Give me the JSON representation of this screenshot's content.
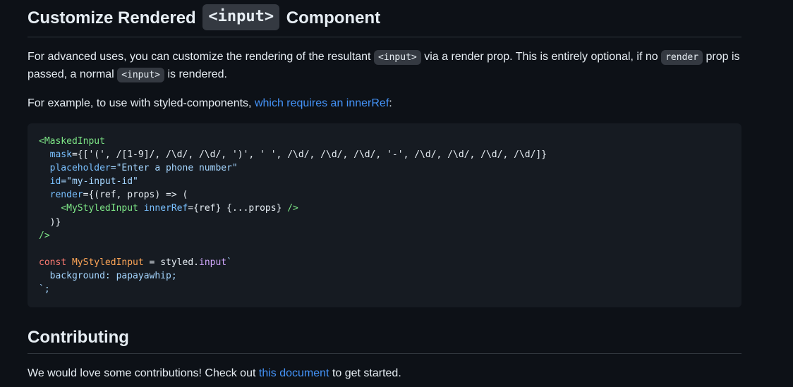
{
  "section1": {
    "heading_before": "Customize Rendered",
    "heading_code": "<input>",
    "heading_after": "Component",
    "p1": {
      "t1": "For advanced uses, you can customize the rendering of the resultant",
      "code1": "<input>",
      "t2": "via a render prop. This is entirely optional, if no",
      "code2": "render",
      "t3": "prop is passed, a normal",
      "code3": "<input>",
      "t4": "is rendered."
    },
    "p2": {
      "t1": "For example, to use with styled-components,",
      "link": "which requires an innerRef",
      "t2": ":"
    }
  },
  "code_block": {
    "l1_tag": "<MaskedInput",
    "l2_attr": "mask",
    "l2_val": "={['(', /[1-9]/, /\\d/, /\\d/, ')', ' ', /\\d/, /\\d/, /\\d/, '-', /\\d/, /\\d/, /\\d/, /\\d/]}",
    "l3_attr": "placeholder",
    "l3_val": "=\"Enter a phone number\"",
    "l4_attr": "id",
    "l4_val": "=\"my-input-id\"",
    "l5_attr": "render",
    "l5_val": "={(ref, props) => (",
    "l6_tag": "<MyStyledInput",
    "l6_attr": "innerRef",
    "l6_val": "={ref} {...props}",
    "l6_close": "/>",
    "l7": ")}",
    "l8": "/>",
    "l10_kw": "const",
    "l10_name": "MyStyledInput",
    "l10_eq": " = styled.",
    "l10_fn": "input",
    "l10_tick": "`",
    "l11": "  background: papayawhip;",
    "l12": "`;"
  },
  "section2": {
    "heading": "Contributing",
    "p": {
      "t1": "We would love some contributions! Check out",
      "link": "this document",
      "t2": "to get started."
    }
  }
}
